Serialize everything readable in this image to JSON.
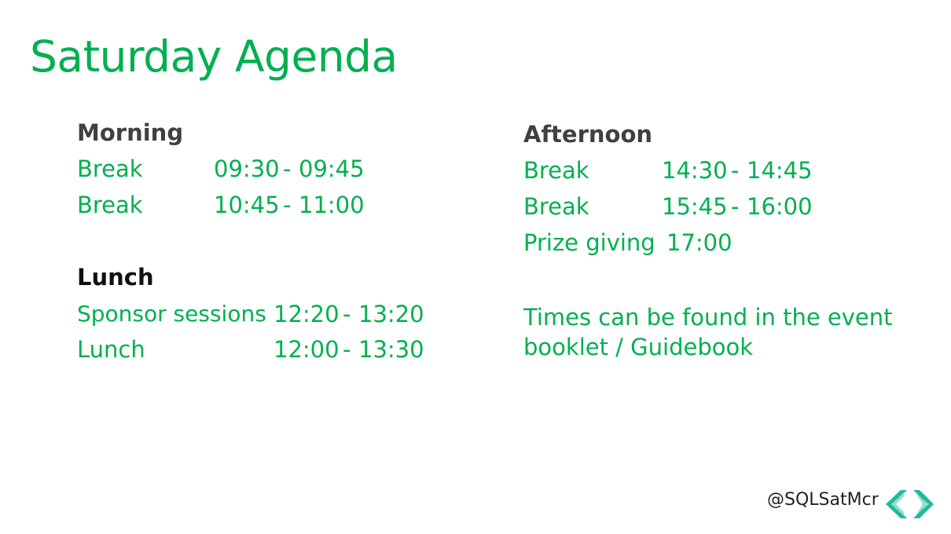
{
  "title": "Saturday Agenda",
  "morning": {
    "heading": "Morning",
    "rows": [
      {
        "label": "Break",
        "start": "09:30",
        "sep": "-",
        "end": "09:45"
      },
      {
        "label": "Break",
        "start": "10:45",
        "sep": "-",
        "end": "11:00"
      }
    ]
  },
  "lunch": {
    "heading": "Lunch",
    "rows": [
      {
        "label": "Sponsor sessions",
        "start": "12:20",
        "sep": "-",
        "end": "13:20"
      },
      {
        "label": "Lunch",
        "start": "12:00",
        "sep": "-",
        "end": "13:30"
      }
    ]
  },
  "afternoon": {
    "heading": "Afternoon",
    "rows": [
      {
        "label": "Break",
        "start": "14:30",
        "sep": "-",
        "end": "14:45"
      },
      {
        "label": "Break",
        "start": "15:45",
        "sep": "-",
        "end": "16:00"
      },
      {
        "label": "Prize giving",
        "time": "17:00"
      }
    ]
  },
  "note": "Times can be found in the event booklet / Guidebook",
  "footer": {
    "handle": "@SQLSatMcr",
    "logo_icon": "chevrons-logo-icon"
  },
  "colors": {
    "accent": "#00b050",
    "heading": "#404040",
    "logo_teal": "#1fb9a0"
  }
}
